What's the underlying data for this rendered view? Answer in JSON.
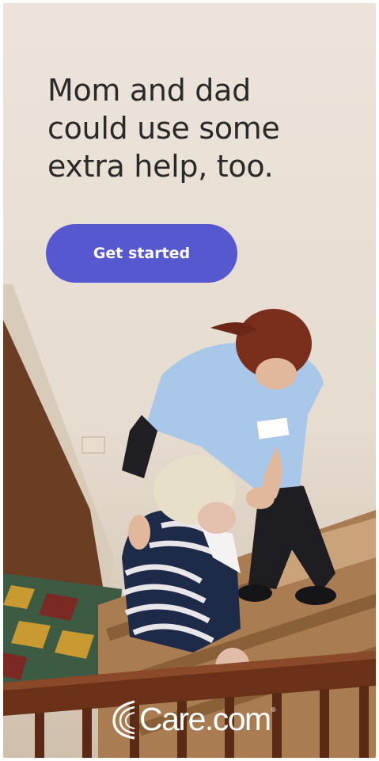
{
  "headline": "Mom and dad\ncould use some\nextra help, too.",
  "cta_label": "Get started",
  "brand": {
    "name": "Care.com",
    "registered_mark": "®",
    "logo_icon": "care-swirl-icon"
  },
  "colors": {
    "background": "#ebe3da",
    "cta": "#5658d0",
    "headline": "#2b2a2a"
  }
}
